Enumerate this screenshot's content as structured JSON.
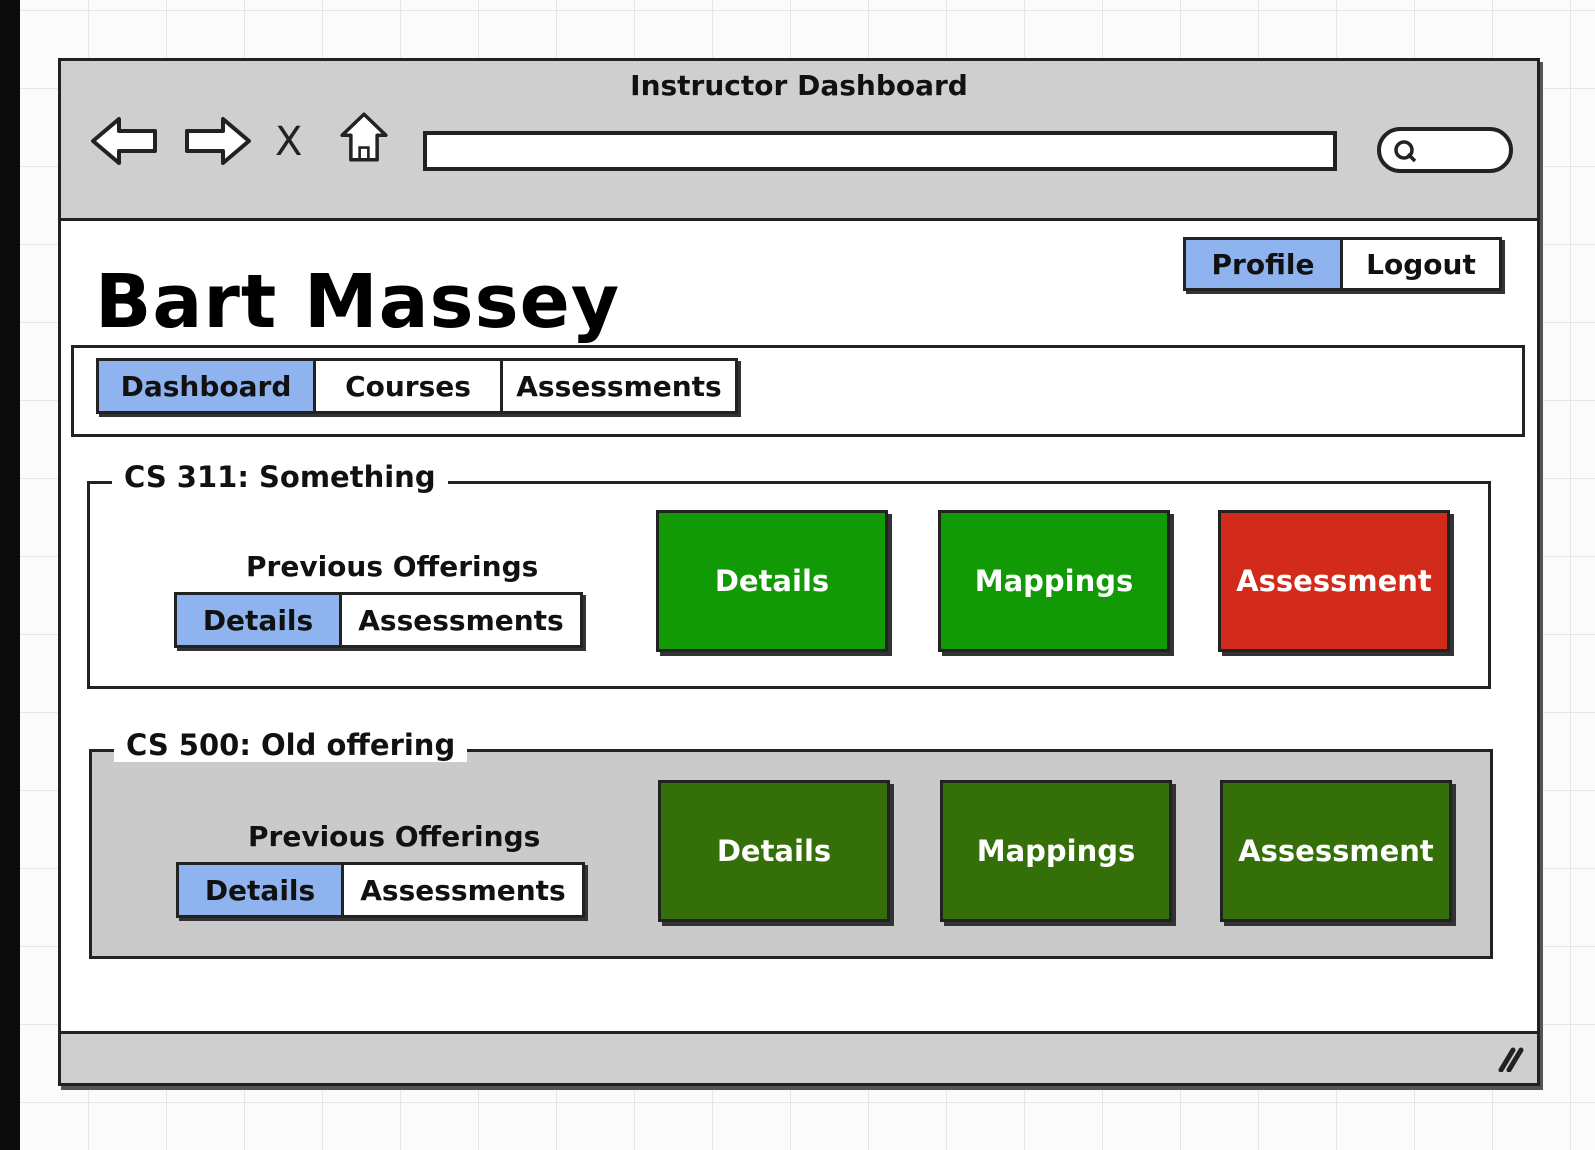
{
  "window": {
    "title": "Instructor Dashboard"
  },
  "browser": {
    "back_icon": "back-arrow-icon",
    "forward_icon": "forward-arrow-icon",
    "stop_label": "X",
    "home_icon": "home-icon",
    "url_value": "",
    "search_icon": "search-icon"
  },
  "header": {
    "user_name": "Bart Massey",
    "profile_label": "Profile",
    "logout_label": "Logout"
  },
  "tabs": [
    {
      "label": "Dashboard",
      "active": true
    },
    {
      "label": "Courses",
      "active": false
    },
    {
      "label": "Assessments",
      "active": false
    }
  ],
  "courses": [
    {
      "title": "CS 311: Something",
      "state": "current",
      "previous_offerings_label": "Previous Offerings",
      "sub_tabs": [
        "Details",
        "Assessments"
      ],
      "actions": [
        {
          "label": "Details",
          "color": "#129a06"
        },
        {
          "label": "Mappings",
          "color": "#129a06"
        },
        {
          "label": "Assessment",
          "color": "#d22b1c"
        }
      ]
    },
    {
      "title": "CS 500: Old offering",
      "state": "old",
      "previous_offerings_label": "Previous Offerings",
      "sub_tabs": [
        "Details",
        "Assessments"
      ],
      "actions": [
        {
          "label": "Details",
          "color": "#356f09"
        },
        {
          "label": "Mappings",
          "color": "#356f09"
        },
        {
          "label": "Assessment",
          "color": "#356f09"
        }
      ]
    }
  ],
  "colors": {
    "active_tab": "#8fb3ee",
    "chrome_gray": "#cfcfcf",
    "inactive_group": "#cacaca"
  }
}
